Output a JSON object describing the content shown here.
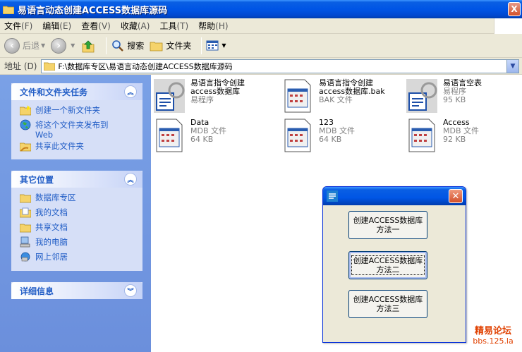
{
  "window": {
    "title": "易语言动态创建ACCESS数据库源码",
    "close_glyph": "X"
  },
  "menu": [
    {
      "label": "文件",
      "key": "(F)"
    },
    {
      "label": "编辑",
      "key": "(E)"
    },
    {
      "label": "查看",
      "key": "(V)"
    },
    {
      "label": "收藏",
      "key": "(A)"
    },
    {
      "label": "工具",
      "key": "(T)"
    },
    {
      "label": "帮助",
      "key": "(H)"
    }
  ],
  "toolbar": {
    "back": "后退",
    "search": "搜索",
    "folders": "文件夹"
  },
  "address": {
    "label": "地址 (D)",
    "path": "F:\\数据库专区\\易语言动态创建ACCESS数据库源码"
  },
  "tasks_panel": {
    "title": "文件和文件夹任务",
    "items": [
      "创建一个新文件夹",
      "将这个文件夹发布到\nWeb",
      "共享此文件夹"
    ]
  },
  "places_panel": {
    "title": "其它位置",
    "items": [
      "数据库专区",
      "我的文档",
      "共享文档",
      "我的电脑",
      "网上邻居"
    ]
  },
  "details_panel": {
    "title": "详细信息"
  },
  "files": [
    {
      "name": "易语言指令创建\naccess数据库",
      "type": "易程序",
      "size": ""
    },
    {
      "name": "易语言指令创建\naccess数据库.bak",
      "type": "BAK 文件",
      "size": ""
    },
    {
      "name": "易语言空表",
      "type": "易程序",
      "size": "95 KB"
    },
    {
      "name": "Data",
      "type": "MDB 文件",
      "size": "64 KB"
    },
    {
      "name": "123",
      "type": "MDB 文件",
      "size": "64 KB"
    },
    {
      "name": "Access",
      "type": "MDB 文件",
      "size": "92 KB"
    }
  ],
  "dialog": {
    "close_glyph": "✕",
    "buttons": [
      "创建ACCESS数据库\n方法一",
      "创建ACCESS数据库\n方法二",
      "创建ACCESS数据库\n方法三"
    ]
  },
  "watermark": {
    "line1": "精易论坛",
    "line2": "bbs.125.la"
  },
  "colors": {
    "xp_blue": "#0055e5",
    "task_link": "#215dc6",
    "watermark": "#e04000"
  }
}
